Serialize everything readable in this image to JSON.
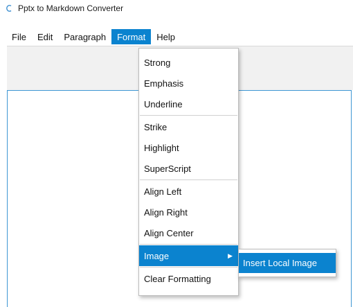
{
  "window": {
    "title": "Pptx to Markdown Converter"
  },
  "menubar": {
    "items": [
      {
        "label": "File"
      },
      {
        "label": "Edit"
      },
      {
        "label": "Paragraph"
      },
      {
        "label": "Format"
      },
      {
        "label": "Help"
      }
    ]
  },
  "format_menu": {
    "items": [
      {
        "label": "Strong"
      },
      {
        "label": "Emphasis"
      },
      {
        "label": "Underline"
      },
      {
        "label": "Strike"
      },
      {
        "label": "Highlight"
      },
      {
        "label": "SuperScript"
      },
      {
        "label": "Align Left"
      },
      {
        "label": "Align Right"
      },
      {
        "label": "Align Center"
      },
      {
        "label": "Image"
      },
      {
        "label": "Clear Formatting"
      }
    ]
  },
  "image_submenu": {
    "items": [
      {
        "label": "Insert Local Image"
      }
    ]
  },
  "icons": {
    "app": "app-icon",
    "submenu_arrow": "chevron-right-icon"
  },
  "colors": {
    "accent": "#0b83cf",
    "editor_border": "#3d96d3",
    "toolbar_bg": "#f1f1f1"
  }
}
